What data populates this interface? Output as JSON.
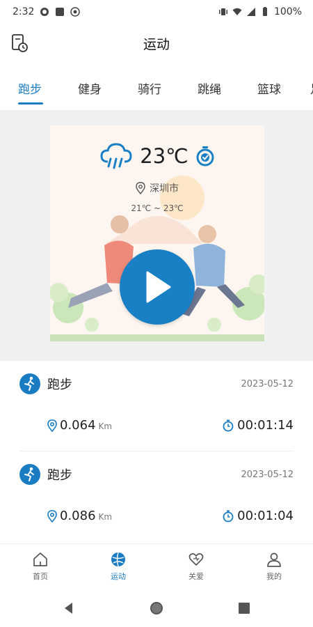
{
  "status_bar": {
    "time": "2:32",
    "battery": "100%"
  },
  "header": {
    "title": "运动"
  },
  "tabs": [
    {
      "label": "跑步",
      "active": true
    },
    {
      "label": "健身",
      "active": false
    },
    {
      "label": "骑行",
      "active": false
    },
    {
      "label": "跳绳",
      "active": false
    },
    {
      "label": "篮球",
      "active": false
    }
  ],
  "weather": {
    "temperature": "23℃",
    "location": "深圳市",
    "range": "21℃ ~ 23℃",
    "icon": "cloud-rain-icon"
  },
  "records": [
    {
      "type": "跑步",
      "date": "2023-05-12",
      "distance": "0.064",
      "unit": "Km",
      "duration": "00:01:14"
    },
    {
      "type": "跑步",
      "date": "2023-05-12",
      "distance": "0.086",
      "unit": "Km",
      "duration": "00:01:04"
    }
  ],
  "bottom_nav": [
    {
      "label": "首页",
      "icon": "home-icon",
      "active": false
    },
    {
      "label": "运动",
      "icon": "sport-icon",
      "active": true
    },
    {
      "label": "关爱",
      "icon": "heart-icon",
      "active": false
    },
    {
      "label": "我的",
      "icon": "user-icon",
      "active": false
    }
  ],
  "colors": {
    "accent": "#1a7dc4",
    "hero_bg": "#f0f0f0"
  }
}
